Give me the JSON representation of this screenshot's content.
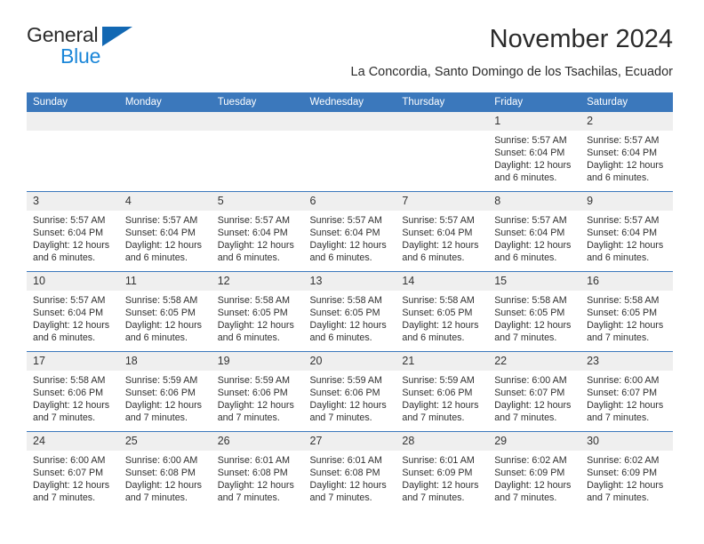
{
  "brand": {
    "name_top": "General",
    "name_bottom": "Blue",
    "triangle_color": "#1268b3",
    "blue_color": "#1a86d8"
  },
  "header": {
    "title": "November 2024",
    "subtitle": "La Concordia, Santo Domingo de los Tsachilas, Ecuador"
  },
  "theme": {
    "header_blue": "#3b78bc",
    "daynum_background": "#efefef",
    "text_color": "#2f2f2f"
  },
  "calendar": {
    "weekday_headers": [
      "Sunday",
      "Monday",
      "Tuesday",
      "Wednesday",
      "Thursday",
      "Friday",
      "Saturday"
    ],
    "labels": {
      "sunrise": "Sunrise:",
      "sunset": "Sunset:",
      "daylight": "Daylight:"
    },
    "weeks": [
      [
        {
          "day": "",
          "sunrise": "",
          "sunset": "",
          "daylight": ""
        },
        {
          "day": "",
          "sunrise": "",
          "sunset": "",
          "daylight": ""
        },
        {
          "day": "",
          "sunrise": "",
          "sunset": "",
          "daylight": ""
        },
        {
          "day": "",
          "sunrise": "",
          "sunset": "",
          "daylight": ""
        },
        {
          "day": "",
          "sunrise": "",
          "sunset": "",
          "daylight": ""
        },
        {
          "day": "1",
          "sunrise": "Sunrise: 5:57 AM",
          "sunset": "Sunset: 6:04 PM",
          "daylight": "Daylight: 12 hours and 6 minutes."
        },
        {
          "day": "2",
          "sunrise": "Sunrise: 5:57 AM",
          "sunset": "Sunset: 6:04 PM",
          "daylight": "Daylight: 12 hours and 6 minutes."
        }
      ],
      [
        {
          "day": "3",
          "sunrise": "Sunrise: 5:57 AM",
          "sunset": "Sunset: 6:04 PM",
          "daylight": "Daylight: 12 hours and 6 minutes."
        },
        {
          "day": "4",
          "sunrise": "Sunrise: 5:57 AM",
          "sunset": "Sunset: 6:04 PM",
          "daylight": "Daylight: 12 hours and 6 minutes."
        },
        {
          "day": "5",
          "sunrise": "Sunrise: 5:57 AM",
          "sunset": "Sunset: 6:04 PM",
          "daylight": "Daylight: 12 hours and 6 minutes."
        },
        {
          "day": "6",
          "sunrise": "Sunrise: 5:57 AM",
          "sunset": "Sunset: 6:04 PM",
          "daylight": "Daylight: 12 hours and 6 minutes."
        },
        {
          "day": "7",
          "sunrise": "Sunrise: 5:57 AM",
          "sunset": "Sunset: 6:04 PM",
          "daylight": "Daylight: 12 hours and 6 minutes."
        },
        {
          "day": "8",
          "sunrise": "Sunrise: 5:57 AM",
          "sunset": "Sunset: 6:04 PM",
          "daylight": "Daylight: 12 hours and 6 minutes."
        },
        {
          "day": "9",
          "sunrise": "Sunrise: 5:57 AM",
          "sunset": "Sunset: 6:04 PM",
          "daylight": "Daylight: 12 hours and 6 minutes."
        }
      ],
      [
        {
          "day": "10",
          "sunrise": "Sunrise: 5:57 AM",
          "sunset": "Sunset: 6:04 PM",
          "daylight": "Daylight: 12 hours and 6 minutes."
        },
        {
          "day": "11",
          "sunrise": "Sunrise: 5:58 AM",
          "sunset": "Sunset: 6:05 PM",
          "daylight": "Daylight: 12 hours and 6 minutes."
        },
        {
          "day": "12",
          "sunrise": "Sunrise: 5:58 AM",
          "sunset": "Sunset: 6:05 PM",
          "daylight": "Daylight: 12 hours and 6 minutes."
        },
        {
          "day": "13",
          "sunrise": "Sunrise: 5:58 AM",
          "sunset": "Sunset: 6:05 PM",
          "daylight": "Daylight: 12 hours and 6 minutes."
        },
        {
          "day": "14",
          "sunrise": "Sunrise: 5:58 AM",
          "sunset": "Sunset: 6:05 PM",
          "daylight": "Daylight: 12 hours and 6 minutes."
        },
        {
          "day": "15",
          "sunrise": "Sunrise: 5:58 AM",
          "sunset": "Sunset: 6:05 PM",
          "daylight": "Daylight: 12 hours and 7 minutes."
        },
        {
          "day": "16",
          "sunrise": "Sunrise: 5:58 AM",
          "sunset": "Sunset: 6:05 PM",
          "daylight": "Daylight: 12 hours and 7 minutes."
        }
      ],
      [
        {
          "day": "17",
          "sunrise": "Sunrise: 5:58 AM",
          "sunset": "Sunset: 6:06 PM",
          "daylight": "Daylight: 12 hours and 7 minutes."
        },
        {
          "day": "18",
          "sunrise": "Sunrise: 5:59 AM",
          "sunset": "Sunset: 6:06 PM",
          "daylight": "Daylight: 12 hours and 7 minutes."
        },
        {
          "day": "19",
          "sunrise": "Sunrise: 5:59 AM",
          "sunset": "Sunset: 6:06 PM",
          "daylight": "Daylight: 12 hours and 7 minutes."
        },
        {
          "day": "20",
          "sunrise": "Sunrise: 5:59 AM",
          "sunset": "Sunset: 6:06 PM",
          "daylight": "Daylight: 12 hours and 7 minutes."
        },
        {
          "day": "21",
          "sunrise": "Sunrise: 5:59 AM",
          "sunset": "Sunset: 6:06 PM",
          "daylight": "Daylight: 12 hours and 7 minutes."
        },
        {
          "day": "22",
          "sunrise": "Sunrise: 6:00 AM",
          "sunset": "Sunset: 6:07 PM",
          "daylight": "Daylight: 12 hours and 7 minutes."
        },
        {
          "day": "23",
          "sunrise": "Sunrise: 6:00 AM",
          "sunset": "Sunset: 6:07 PM",
          "daylight": "Daylight: 12 hours and 7 minutes."
        }
      ],
      [
        {
          "day": "24",
          "sunrise": "Sunrise: 6:00 AM",
          "sunset": "Sunset: 6:07 PM",
          "daylight": "Daylight: 12 hours and 7 minutes."
        },
        {
          "day": "25",
          "sunrise": "Sunrise: 6:00 AM",
          "sunset": "Sunset: 6:08 PM",
          "daylight": "Daylight: 12 hours and 7 minutes."
        },
        {
          "day": "26",
          "sunrise": "Sunrise: 6:01 AM",
          "sunset": "Sunset: 6:08 PM",
          "daylight": "Daylight: 12 hours and 7 minutes."
        },
        {
          "day": "27",
          "sunrise": "Sunrise: 6:01 AM",
          "sunset": "Sunset: 6:08 PM",
          "daylight": "Daylight: 12 hours and 7 minutes."
        },
        {
          "day": "28",
          "sunrise": "Sunrise: 6:01 AM",
          "sunset": "Sunset: 6:09 PM",
          "daylight": "Daylight: 12 hours and 7 minutes."
        },
        {
          "day": "29",
          "sunrise": "Sunrise: 6:02 AM",
          "sunset": "Sunset: 6:09 PM",
          "daylight": "Daylight: 12 hours and 7 minutes."
        },
        {
          "day": "30",
          "sunrise": "Sunrise: 6:02 AM",
          "sunset": "Sunset: 6:09 PM",
          "daylight": "Daylight: 12 hours and 7 minutes."
        }
      ]
    ]
  }
}
